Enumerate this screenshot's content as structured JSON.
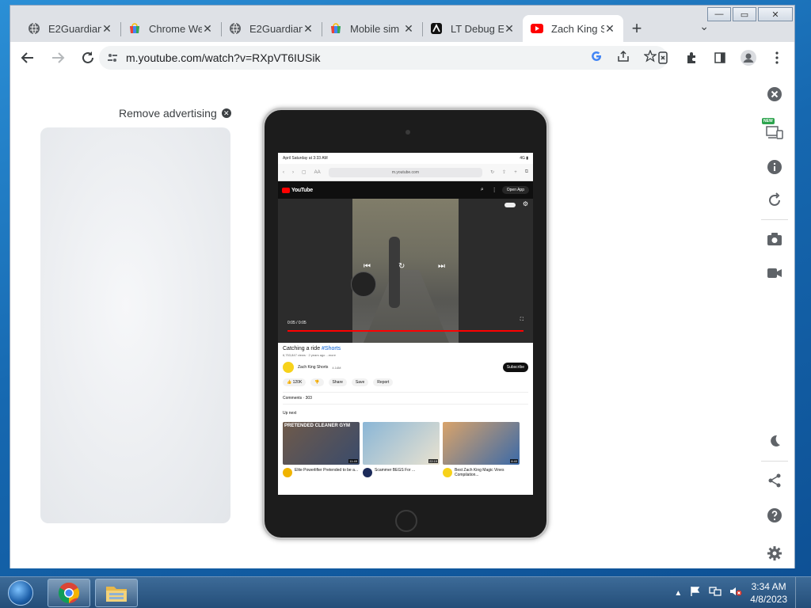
{
  "browser": {
    "tabs": [
      {
        "title": "E2Guardian",
        "icon": "globe-icon"
      },
      {
        "title": "Chrome We",
        "icon": "chrome-webstore-icon"
      },
      {
        "title": "E2Guardian",
        "icon": "globe-icon"
      },
      {
        "title": "Mobile sim",
        "icon": "chrome-webstore-icon"
      },
      {
        "title": "LT Debug E",
        "icon": "lambdatest-icon"
      },
      {
        "title": "Zach King S",
        "icon": "youtube-icon",
        "active": true
      }
    ],
    "url": "m.youtube.com/watch?v=RXpVT6IUSik",
    "new_tab_symbol": "+",
    "dropdown_symbol": "⌄"
  },
  "page": {
    "remove_ad_label": "Remove advertising"
  },
  "device": {
    "status_left": "April Saturday at 3:33 AM",
    "status_right": "4G ▮",
    "safari_aa": "AA",
    "safari_url": "m.youtube.com",
    "yt_brand": "YouTube",
    "open_app": "Open App",
    "video_time": "0:05 / 0:05",
    "video_title": "Catching a ride ",
    "video_tag": "#Shorts",
    "video_meta": "6,753,847 views · 2 years ago  ...more",
    "channel_name": "Zach King Shorts",
    "channel_subs": "4.14M",
    "subscribe": "Subscribe",
    "actions": [
      "120K",
      "Share",
      "Save",
      "Report"
    ],
    "comments": "Comments · 303",
    "up_next": "Up next",
    "thumbs": [
      {
        "title": "Elite Powerlifter Pretended to be a...",
        "duration": "11:49",
        "caption": "PRETENDED  CLEANER  GYM",
        "color": "#6f5a4a",
        "avatar": "#f0b400"
      },
      {
        "title": "Scammer BEGS For ...",
        "duration": "22:19",
        "caption": "",
        "color": "#8ab6d6",
        "avatar": "#1c2b5a"
      },
      {
        "title": "Best Zach King Magic Vines Compilation...",
        "duration": "8:40",
        "caption": "",
        "color": "#d9a36a",
        "avatar": "#f7d21b"
      }
    ]
  },
  "taskbar": {
    "time": "3:34 AM",
    "date": "4/8/2023"
  },
  "colors": {
    "youtube_red": "#ff0000",
    "chrome_tab_active": "#ffffff",
    "taskbar": "#2d5a87"
  }
}
